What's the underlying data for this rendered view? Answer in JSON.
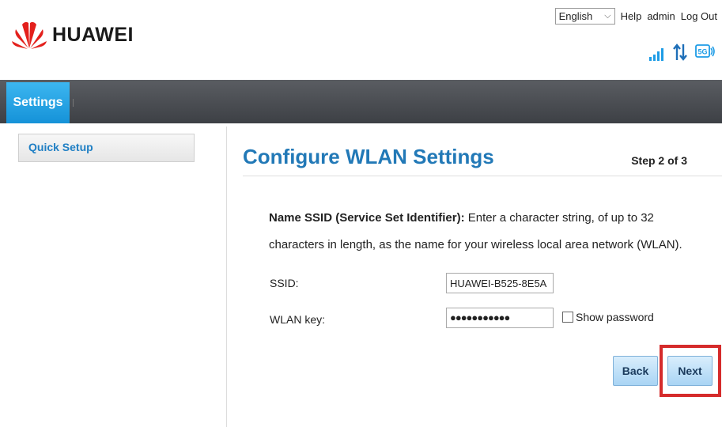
{
  "brand": {
    "name": "HUAWEI"
  },
  "top_bar": {
    "language": "English",
    "links": [
      "Help",
      "admin",
      "Log Out"
    ]
  },
  "status_icons": [
    "signal-strength-icon",
    "data-transfer-icon",
    "5g-icon"
  ],
  "status_icon_labels": {
    "network_type": "5G"
  },
  "nav": {
    "active_tab": "Settings"
  },
  "sidebar": {
    "items": [
      {
        "label": "Quick Setup"
      }
    ]
  },
  "main": {
    "title": "Configure WLAN Settings",
    "step": "Step 2 of 3",
    "desc_bold": "Name SSID (Service Set Identifier):",
    "desc_text": " Enter a character string, of up to 32 characters in length, as the name for your wireless local area network (WLAN).",
    "ssid_label": "SSID:",
    "ssid_value": "HUAWEI-B525-8E5A",
    "key_label": "WLAN key:",
    "key_value": "●●●●●●●●●●●",
    "show_password_label": "Show password",
    "back_label": "Back",
    "next_label": "Next"
  },
  "colors": {
    "accent": "#1592d8",
    "title_blue": "#2279b7",
    "highlight_red": "#d52b2b",
    "nav_dark": "#3d4045"
  }
}
